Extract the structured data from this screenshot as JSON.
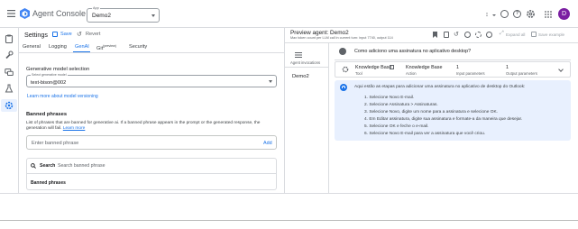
{
  "topbar": {
    "title": "Agent Console",
    "app_select_label": "App",
    "app_select_value": "Demo2",
    "avatar_letter": "D"
  },
  "settings": {
    "title": "Settings",
    "save_label": "Save",
    "revert_label": "Revert",
    "tabs": [
      "General",
      "Logging",
      "GenAI",
      "Git",
      "Security"
    ],
    "git_badge": "(preview)",
    "active_tab": "GenAI"
  },
  "genai": {
    "model_section_title": "Generative model selection",
    "model_field_label": "Select generative model",
    "model_field_value": "text-bison@002",
    "learn_more_model": "Learn more about model versioning",
    "banned_title": "Banned phrases",
    "banned_desc_1": "List of phrases that are banned for generative ai. If a banned phrase appears in the prompt or the generated response, the",
    "banned_desc_2": "generation will fail.",
    "banned_learn_more": "Learn more",
    "banned_input_placeholder": "Enter banned phrase",
    "add_label": "Add",
    "search_label": "Search",
    "search_placeholder": "Search banned phrase",
    "table_header": "Banned phrases"
  },
  "preview": {
    "title": "Preview agent: Demo2",
    "subtitle": "Max token count per LLM call in current turn: input 7740, output 114",
    "expand_all": "Expand all",
    "save_example": "Save example",
    "invocations_label": "Agent invocations",
    "agent_name": "Demo2",
    "user_message": "Como adiciono uma assinatura no aplicativo desktop?",
    "tool_name": "Knowledge Base",
    "tool_type": "Tool",
    "action_name": "Knowledge Base",
    "action_type": "Action",
    "input_count": "1",
    "input_label": "Input parameters",
    "output_count": "1",
    "output_label": "Output parameters",
    "answer_intro": "Aqui estão as etapas para adicionar uma assinatura no aplicativo de desktop do Outlook:",
    "steps": [
      "1. Selecione Novo E-mail.",
      "2. Selecione Assinatura > Assinaturas.",
      "3. Selecione Novo, digite um nome para a assinatura e selecione OK.",
      "4. Em Editar assinatura, digite sua assinatura e formate-a da maneira que desejar.",
      "5. Selecione OK e feche o e-mail.",
      "6. Selecione Novo E-mail para ver a assinatura que você criou."
    ]
  }
}
